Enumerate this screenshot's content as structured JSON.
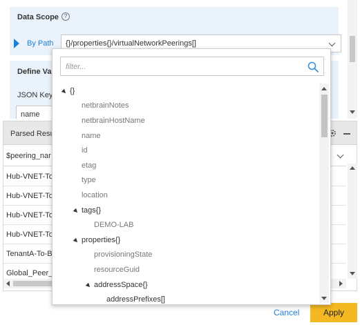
{
  "data_scope": {
    "title": "Data Scope",
    "help_icon": "?",
    "mode_label": "By Path",
    "path_value": "{}/properties{}/virtualNetworkPeerings[]"
  },
  "define_values": {
    "title": "Define Va",
    "json_key_label": "JSON Key",
    "json_key_value": "name"
  },
  "dropdown": {
    "filter_placeholder": "filter...",
    "tree": [
      {
        "label": "{}",
        "expandable": true
      },
      {
        "label": "netbrainNotes",
        "expandable": false
      },
      {
        "label": "netbrainHostName",
        "expandable": false
      },
      {
        "label": "name",
        "expandable": false
      },
      {
        "label": "id",
        "expandable": false
      },
      {
        "label": "etag",
        "expandable": false
      },
      {
        "label": "type",
        "expandable": false
      },
      {
        "label": "location",
        "expandable": false
      },
      {
        "label": "tags{}",
        "expandable": true
      },
      {
        "label": "DEMO-LAB",
        "expandable": false
      },
      {
        "label": "properties{}",
        "expandable": true
      },
      {
        "label": "provisioningState",
        "expandable": false
      },
      {
        "label": "resourceGuid",
        "expandable": false
      },
      {
        "label": "addressSpace{}",
        "expandable": true
      },
      {
        "label": "addressPrefixes[]",
        "expandable": false
      }
    ]
  },
  "parsed_results": {
    "title": "Parsed Resu",
    "column_header": "$peering_nar",
    "rows": [
      "Hub-VNET-To",
      "Hub-VNET-To",
      "Hub-VNET-To",
      "Hub-VNET-To",
      "TenantA-To-B",
      "Global_Peer_1"
    ]
  },
  "footer": {
    "cancel_label": "Cancel",
    "apply_label": "Apply"
  },
  "colors": {
    "accent_blue": "#1e7fd8",
    "apply_button": "#f4b922",
    "panel_bg": "#eaf3fb"
  }
}
